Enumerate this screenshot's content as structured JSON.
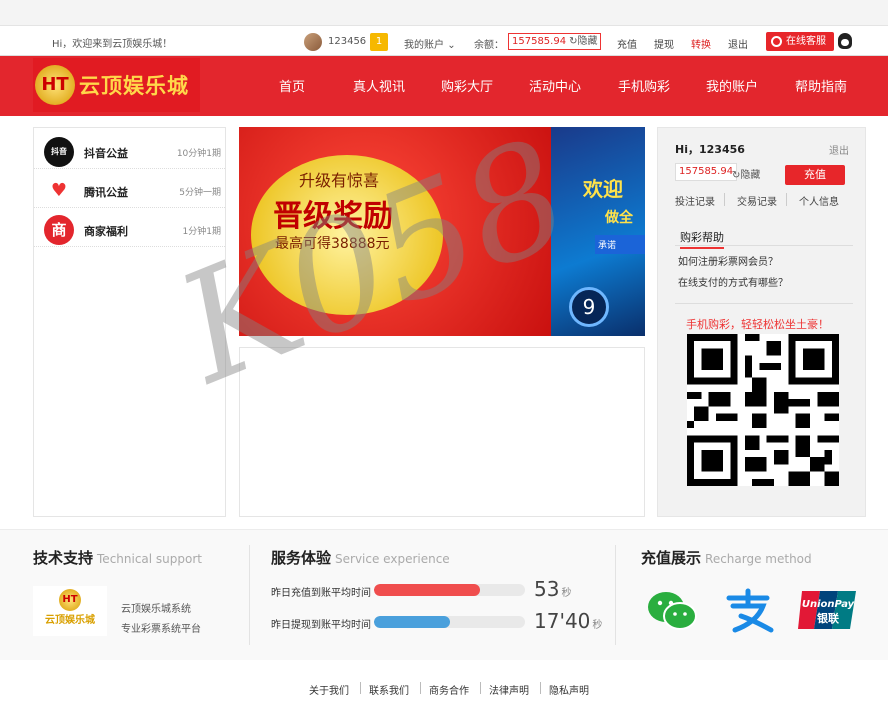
{
  "topbar": {
    "welcome": "Hi，欢迎来到云顶娱乐城！",
    "username": "123456",
    "badge": "1",
    "my_account": "我的账户",
    "balance_label": "余额：",
    "balance": "157585.94",
    "hide": "隐藏",
    "links": [
      "充值",
      "提现",
      "转换",
      "退出"
    ],
    "service": "在线客服"
  },
  "nav": {
    "logo_mark": "HT",
    "logo_text": "云顶娱乐城",
    "items": [
      "首页",
      "真人视讯",
      "购彩大厅",
      "活动中心",
      "手机购彩",
      "我的账户",
      "帮助指南"
    ]
  },
  "notices": [
    {
      "icon": "抖音",
      "title": "抖音公益",
      "time": "10分钟1期"
    },
    {
      "icon": "♥",
      "title": "腾讯公益",
      "time": "5分钟一期"
    },
    {
      "icon": "商",
      "title": "商家福利",
      "time": "1分钟1期"
    }
  ],
  "banner": {
    "line1": "升级有惊喜",
    "line2": "晋级奖励",
    "line3": "最高可得38888元",
    "side1": "欢迎",
    "side2": "做全",
    "side3": "承诺",
    "side_num": "9"
  },
  "side": {
    "hi": "Hi，123456",
    "logout": "退出",
    "balance": "157585.94",
    "hide": "隐藏",
    "recharge": "充值",
    "records": [
      "投注记录",
      "交易记录",
      "个人信息"
    ],
    "help_title": "购彩帮助",
    "questions": [
      "如何注册彩票网会员？",
      "在线支付的方式有哪些？"
    ],
    "mobile_text": "手机购彩，轻轻松松坐土豪！"
  },
  "footer": {
    "tech_title": "技术支持",
    "tech_en": "Technical support",
    "logo_name": "云顶娱乐城",
    "tech_line1": "云顶娱乐城系统",
    "tech_line2": "专业彩票系统平台",
    "svc_title": "服务体验",
    "svc_en": "Service experience",
    "svc_rows": [
      {
        "label": "昨日充值到账平均时间",
        "value": "53",
        "unit": "秒",
        "fill": 0.7,
        "color": "#f04e4e"
      },
      {
        "label": "昨日提现到账平均时间",
        "value": "17'40",
        "unit": "秒",
        "fill": 0.5,
        "color": "#4aa0dc"
      }
    ],
    "pay_title": "充值展示",
    "pay_en": "Recharge method",
    "unionpay_text1": "UnionPay",
    "unionpay_text2": "银联",
    "links": [
      "关于我们",
      "联系我们",
      "商务合作",
      "法律声明",
      "隐私声明"
    ]
  },
  "watermark": "K058"
}
